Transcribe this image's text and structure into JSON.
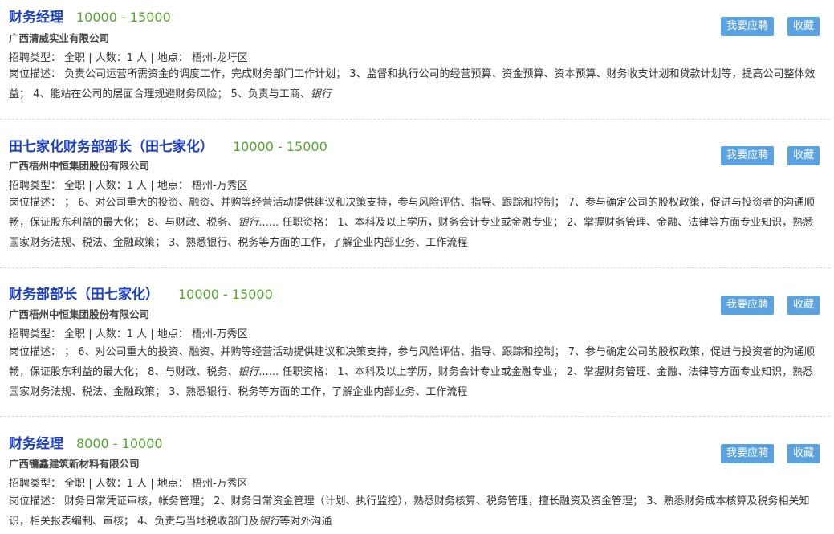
{
  "colors": {
    "title": "#1c3fbf",
    "salary": "#55a630",
    "button": "#5aa3e0"
  },
  "jobs": [
    {
      "title": "财务经理",
      "salary": "10000 - 15000",
      "company": "广西清威实业有限公司",
      "meta": "招聘类型： 全职 | 人数：1 人 | 地点： 梧州-龙圩区",
      "desc_label": "岗位描述：",
      "desc_text": "负责公司运营所需资金的调度工作，完成财务部门工作计划； 3、监督和执行公司的经营预算、资金预算、资本预算、财务收支计划和贷款计划等，提高公司整体效益； 4、能站在公司的层面合理规避财务风险； 5、负责与工商、",
      "desc_em": "银行",
      "desc_tail": "",
      "apply_label": "我要应聘",
      "save_label": "收藏"
    },
    {
      "title": "田七家化财务部部长（田七家化）",
      "salary": "10000 - 15000",
      "company": "广西梧州中恒集团股份有限公司",
      "meta": "招聘类型： 全职 | 人数：1 人 | 地点： 梧州-万秀区",
      "desc_label": "岗位描述：",
      "desc_text": "； 6、对公司重大的投资、融资、并购等经营活动提供建议和决策支持，参与风险评估、指导、跟踪和控制； 7、参与确定公司的股权政策，促进与投资者的沟通顺畅，保证股东利益的最大化； 8、与财政、税务、",
      "desc_em": "银行",
      "desc_tail": "...... 任职资格： 1、本科及以上学历，财务会计专业或金融专业； 2、掌握财务管理、金融、法律等方面专业知识，熟悉国家财务法规、税法、金融政策； 3、熟悉银行、税务等方面的工作，了解企业内部业务、工作流程",
      "apply_label": "我要应聘",
      "save_label": "收藏"
    },
    {
      "title": "财务部部长（田七家化）",
      "salary": "10000 - 15000",
      "company": "广西梧州中恒集团股份有限公司",
      "meta": "招聘类型： 全职 | 人数：1 人 | 地点： 梧州-万秀区",
      "desc_label": "岗位描述：",
      "desc_text": "； 6、对公司重大的投资、融资、并购等经营活动提供建议和决策支持，参与风险评估、指导、跟踪和控制； 7、参与确定公司的股权政策，促进与投资者的沟通顺畅，保证股东利益的最大化； 8、与财政、税务、",
      "desc_em": "银行",
      "desc_tail": "...... 任职资格： 1、本科及以上学历，财务会计专业或金融专业； 2、掌握财务管理、金融、法律等方面专业知识，熟悉国家财务法规、税法、金融政策； 3、熟悉银行、税务等方面的工作，了解企业内部业务、工作流程",
      "apply_label": "我要应聘",
      "save_label": "收藏"
    },
    {
      "title": "财务经理",
      "salary": "8000 - 10000",
      "company": "广西镛鑫建筑新材料有限公司",
      "meta": "招聘类型： 全职 | 人数：1 人 | 地点： 梧州-万秀区",
      "desc_label": "岗位描述：",
      "desc_text": "财务日常凭证审核，帐务管理； 2、财务日常资金管理（计划、执行监控），熟悉财务核算、税务管理，擅长融资及资金管理； 3、熟悉财务成本核算及税务相关知识，相关报表编制、审核； 4、负责与当地税收部门及",
      "desc_em": "银行",
      "desc_tail": "等对外沟通",
      "apply_label": "我要应聘",
      "save_label": "收藏"
    }
  ]
}
